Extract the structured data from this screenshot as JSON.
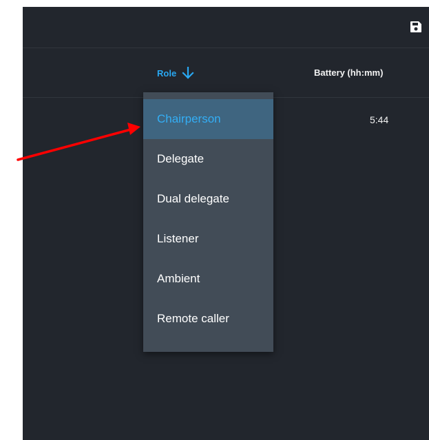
{
  "toolbar": {
    "save_icon": "save-icon"
  },
  "table": {
    "columns": {
      "role": "Role",
      "battery": "Battery (hh:mm)"
    },
    "sort_icon": "arrow-down-icon",
    "rows": [
      {
        "battery": "5:44"
      }
    ]
  },
  "role_dropdown": {
    "selected": "Chairperson",
    "options": [
      "Chairperson",
      "Delegate",
      "Dual delegate",
      "Listener",
      "Ambient",
      "Remote caller"
    ]
  },
  "colors": {
    "background": "#22262d",
    "accent": "#29a8f2",
    "dropdown_bg": "#424c57",
    "selected_bg": "#3f6580",
    "annotation_arrow": "#ff0000"
  }
}
